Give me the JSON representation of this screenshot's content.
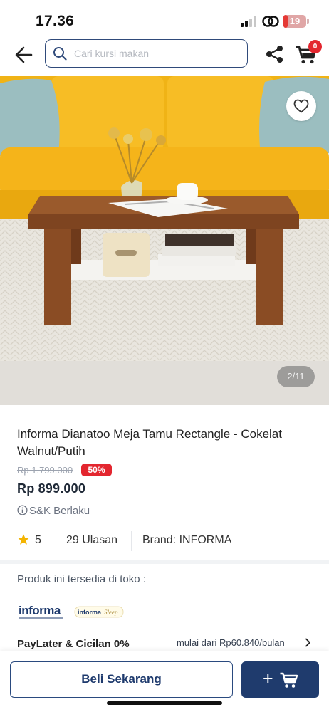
{
  "status_bar": {
    "time": "17.36",
    "battery_level": "19"
  },
  "nav": {
    "search_placeholder": "Cari kursi makan",
    "cart_count": "0"
  },
  "gallery": {
    "counter": "2/11"
  },
  "product": {
    "title": "Informa Dianatoo Meja Tamu Rectangle - Cokelat Walnut/Putih",
    "original_price": "Rp 1.799.000",
    "discount": "50%",
    "price": "Rp 899.000",
    "terms_label": "S&K Berlaku",
    "rating": "5",
    "reviews": "29 Ulasan",
    "brand": "Brand: INFORMA"
  },
  "availability": {
    "store_text": "Produk ini tersedia di toko :",
    "store_logos": [
      "informa",
      "informa Sleep"
    ]
  },
  "paylater": {
    "label": "PayLater & Cicilan 0%",
    "value": "mulai dari Rp60.840/bulan"
  },
  "actions": {
    "buy_now": "Beli Sekarang",
    "add_to_cart": "+"
  },
  "colors": {
    "primary_navy": "#1f3b6d",
    "discount_red": "#e3262f",
    "star": "#f4b400"
  }
}
